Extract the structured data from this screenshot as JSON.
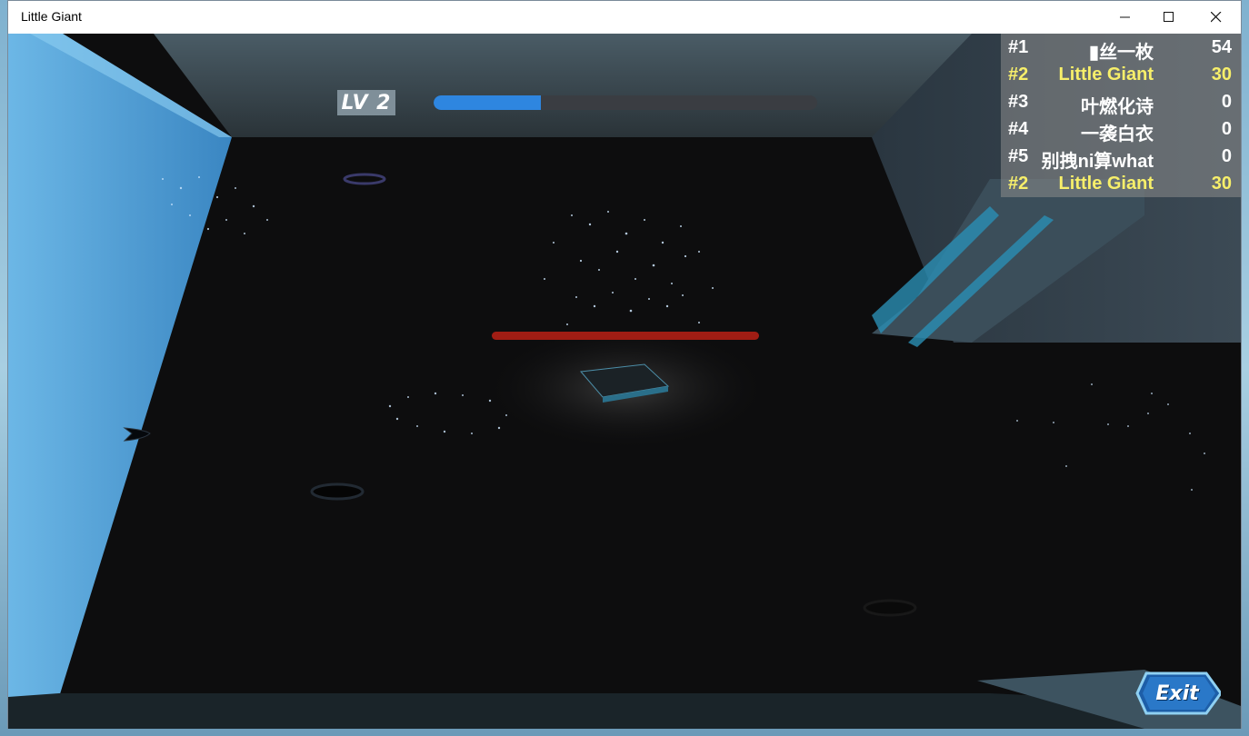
{
  "window": {
    "title": "Little Giant",
    "controls": [
      "minimize-icon",
      "maximize-icon",
      "close-icon"
    ]
  },
  "hud": {
    "level_label": "LV 2",
    "xp_progress": 0.28,
    "xp_color": "#2e86e0"
  },
  "leaderboard": [
    {
      "rank": "#1",
      "name": "▮丝一枚",
      "score": "54",
      "highlight": false
    },
    {
      "rank": "#2",
      "name": "Little Giant",
      "score": "30",
      "highlight": true
    },
    {
      "rank": "#3",
      "name": "叶燃化诗",
      "score": "0",
      "highlight": false
    },
    {
      "rank": "#4",
      "name": "一袭白衣",
      "score": "0",
      "highlight": false
    },
    {
      "rank": "#5",
      "name": "别拽ni算what",
      "score": "0",
      "highlight": false
    },
    {
      "rank": "#2",
      "name": "Little Giant",
      "score": "30",
      "highlight": true
    }
  ],
  "exit_button": {
    "label": "Exit"
  },
  "colors": {
    "highlight": "#f7ef6a",
    "normal": "#ffffff",
    "enemy_hp": "#a01d14"
  }
}
